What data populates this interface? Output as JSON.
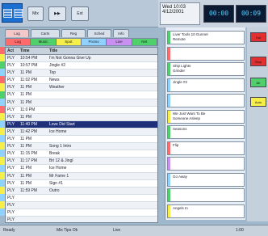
{
  "toolbar": {
    "logo": "▤▤",
    "buttons": [
      "Mix",
      "▶▶",
      "Ext"
    ]
  },
  "clock": {
    "date_line1": "Wed 10:03",
    "date_line2": "4/12/2001",
    "led1": "00:00",
    "led2": "00:09"
  },
  "tabs": [
    "Log",
    "Carts",
    "Reg",
    "Sched",
    "Info"
  ],
  "categories": [
    {
      "label": "Log",
      "color": "#ff6a6a"
    },
    {
      "label": "Music",
      "color": "#4fd06a"
    },
    {
      "label": "Spot",
      "color": "#f6ef4a"
    },
    {
      "label": "Promo",
      "color": "#8fd2ff"
    },
    {
      "label": "Live",
      "color": "#c890f0"
    },
    {
      "label": "Net",
      "color": "#4fd06a"
    }
  ],
  "playlist": {
    "headers": [
      "Act",
      "Time",
      "Title"
    ],
    "rows": [
      {
        "act": "PLY",
        "time": "10:54 PM",
        "title": "I'm Not Gonna Give Up"
      },
      {
        "act": "PLY",
        "time": "10:57 PM",
        "title": "Jingle #2"
      },
      {
        "act": "PLY",
        "time": "11 PM",
        "title": "Top"
      },
      {
        "act": "PLY",
        "time": "11:02 PM",
        "title": "News"
      },
      {
        "act": "PLY",
        "time": "11 PM",
        "title": "Weather"
      },
      {
        "act": "PLY",
        "time": "11 PM",
        "title": ""
      },
      {
        "act": "PLY",
        "time": "11 PM",
        "title": ""
      },
      {
        "act": "PLY",
        "time": "11:0 PM",
        "title": ""
      },
      {
        "act": "PLY",
        "time": "11 PM",
        "title": ""
      },
      {
        "act": "PLY",
        "time": "11:40 PM",
        "title": "Love Did Start"
      },
      {
        "act": "PLY",
        "time": "11:42 PM",
        "title": "Ice Home"
      },
      {
        "act": "PLY",
        "time": "11 PM",
        "title": ""
      },
      {
        "act": "PLY",
        "time": "11 PM",
        "title": "Song 1 Intro"
      },
      {
        "act": "PLY",
        "time": "11:15 PM",
        "title": "Break"
      },
      {
        "act": "PLY",
        "time": "11:17 PM",
        "title": "Bri 12 & Jingl"
      },
      {
        "act": "PLY",
        "time": "11 PM",
        "title": "Ice Home"
      },
      {
        "act": "PLY",
        "time": "11 PM",
        "title": "Mr Fame 1"
      },
      {
        "act": "PLY",
        "time": "11 PM",
        "title": "Sign #1"
      },
      {
        "act": "PLY",
        "time": "11:59 PM",
        "title": "Outro"
      },
      {
        "act": "PLY",
        "time": "",
        "title": ""
      },
      {
        "act": "PLY",
        "time": "",
        "title": ""
      },
      {
        "act": "PLY",
        "time": "",
        "title": ""
      },
      {
        "act": "PLY",
        "time": "",
        "title": ""
      }
    ]
  },
  "carts": [
    {
      "text": "Liver Tools 10 Gunner",
      "sub": "Remote",
      "color": "#4fd06a"
    },
    {
      "text": "",
      "sub": "",
      "color": "#ff6a6a"
    },
    {
      "text": "Ship Lights",
      "sub": "Grinder",
      "color": "#4fd06a"
    },
    {
      "text": "Jingle #2",
      "sub": "",
      "color": "#8fd2ff"
    },
    {
      "text": "",
      "sub": "",
      "color": "#8fd2ff"
    },
    {
      "text": "We Just Want To Be",
      "sub": "Someone Asleep",
      "color": "#f6ef4a"
    },
    {
      "text": "Seasons",
      "sub": "",
      "color": "#4fd06a"
    },
    {
      "text": "Flip",
      "sub": "",
      "color": "#ff6a6a"
    },
    {
      "text": "",
      "sub": "",
      "color": "#c890f0"
    },
    {
      "text": "Go Away",
      "sub": "",
      "color": "#8fd2ff"
    },
    {
      "text": "",
      "sub": "",
      "color": "#4fd06a"
    },
    {
      "text": "Angels In",
      "sub": "",
      "color": "#f6ef4a"
    }
  ],
  "side_buttons": [
    {
      "label": "Hot",
      "color": "#e23030"
    },
    {
      "label": "Stop",
      "color": "#e23030"
    },
    {
      "label": "Air",
      "color": "#4fd06a"
    },
    {
      "label": "Auto",
      "color": "#f6ef4a"
    }
  ],
  "status": {
    "left": "Ready",
    "center": "Mix Tips Ok",
    "mid": "Live",
    "right": "1:00"
  }
}
